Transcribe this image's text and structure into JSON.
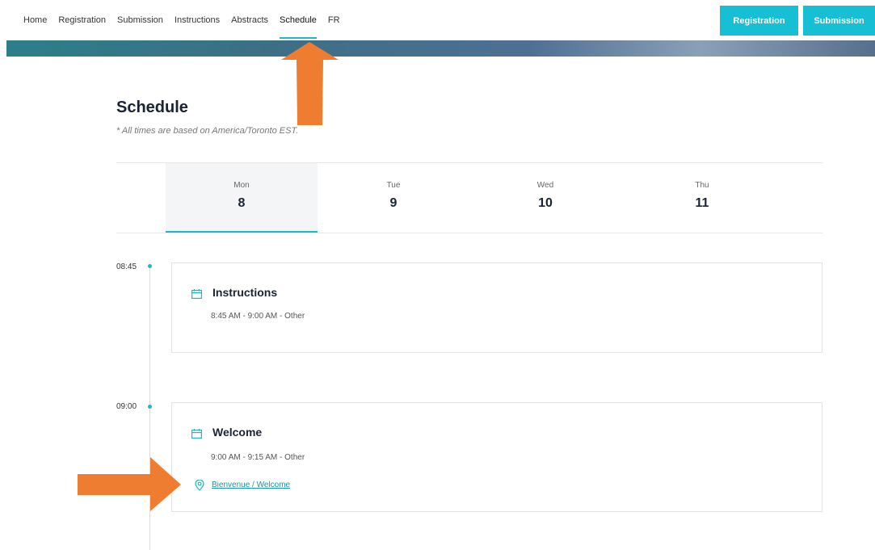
{
  "nav": {
    "links": [
      "Home",
      "Registration",
      "Submission",
      "Instructions",
      "Abstracts",
      "Schedule",
      "FR"
    ],
    "active": "Schedule",
    "buttons": {
      "registration": "Registration",
      "submission": "Submission"
    }
  },
  "page": {
    "title": "Schedule",
    "subtitle": "* All times are based on America/Toronto EST."
  },
  "days": [
    {
      "name": "Mon",
      "num": "8",
      "active": true
    },
    {
      "name": "Tue",
      "num": "9",
      "active": false
    },
    {
      "name": "Wed",
      "num": "10",
      "active": false
    },
    {
      "name": "Thu",
      "num": "11",
      "active": false
    }
  ],
  "events": [
    {
      "time": "08:45",
      "title": "Instructions",
      "meta": "8:45 AM - 9:00 AM - Other",
      "location": ""
    },
    {
      "time": "09:00",
      "title": "Welcome",
      "meta": "9:00 AM - 9:15 AM - Other",
      "location": "Bienvenue / Welcome"
    }
  ],
  "colors": {
    "accent": "#16bfd3",
    "annotation_arrow": "#ee7d32"
  }
}
